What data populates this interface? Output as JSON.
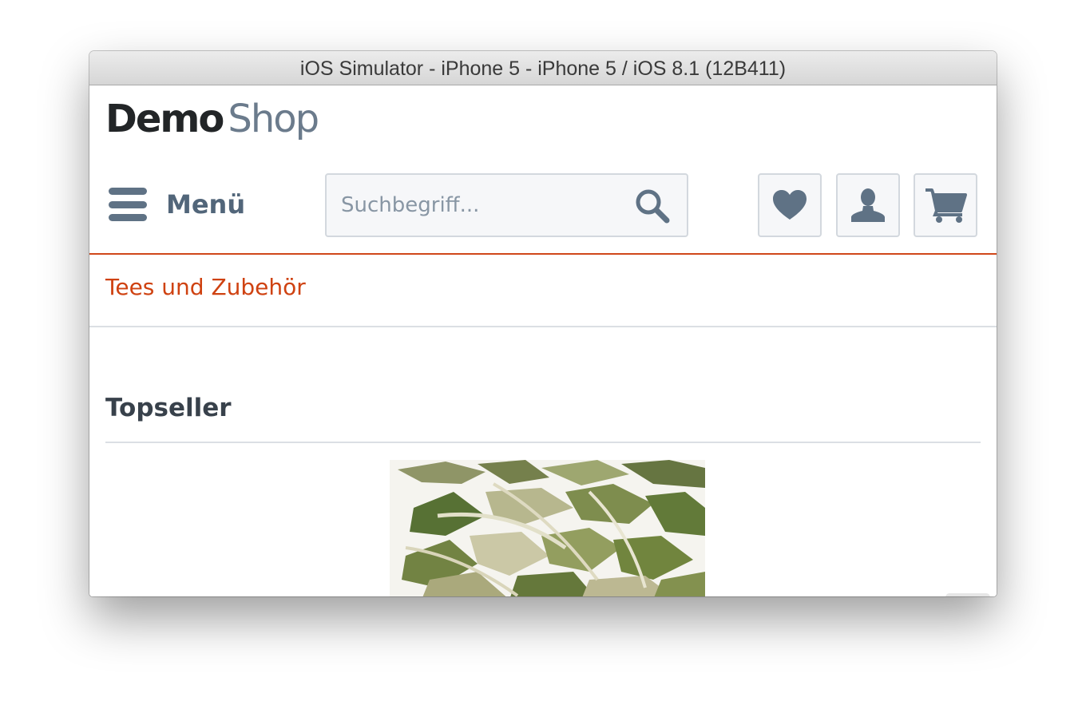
{
  "window": {
    "title": "iOS Simulator - iPhone 5 - iPhone 5 / iOS 8.1 (12B411)"
  },
  "logo": {
    "part1": "Demo",
    "part2": "Shop"
  },
  "header": {
    "menu_label": "Menü",
    "search_placeholder": "Suchbegriff..."
  },
  "icons": {
    "menu": "hamburger-icon",
    "search": "search-icon",
    "wishlist": "heart-icon",
    "account": "user-icon",
    "cart": "cart-icon"
  },
  "breadcrumb": {
    "label": "Tees und Zubehör"
  },
  "main": {
    "section_title": "Topseller"
  },
  "colors": {
    "accent": "#cf4211",
    "icon": "#5f7285",
    "text_dark": "#38414b"
  }
}
